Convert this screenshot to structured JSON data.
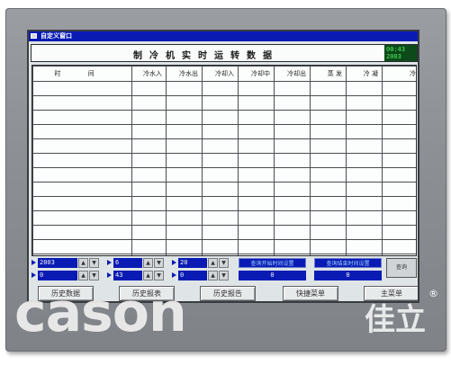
{
  "window": {
    "title": "自定义窗口"
  },
  "header": {
    "title": "制冷机实时运转数据"
  },
  "clock": {
    "time": "00:43",
    "date": "2003"
  },
  "table": {
    "columns": [
      "时 间",
      "冷水入",
      "冷水出",
      "冷却入",
      "冷却中",
      "冷却出",
      "蒸 发",
      "冷 凝",
      "冷"
    ],
    "row_count": 15
  },
  "controls": {
    "year": "2003",
    "month": "6",
    "day": "20",
    "hour": "0",
    "minute": "43",
    "second": "0",
    "query_start_label": "查询开始时间设置",
    "query_end_label": "查询结束时间设置",
    "query_start_value": "0",
    "query_end_value": "0",
    "query_button": "查询"
  },
  "bottom_buttons": [
    {
      "label": "历史数据"
    },
    {
      "label": "历史报表"
    },
    {
      "label": "历史报告"
    },
    {
      "label": "快捷菜单"
    },
    {
      "label": "主菜单"
    }
  ],
  "watermark": {
    "brand": "cason",
    "brand_cn": "佳立",
    "reg": "®"
  }
}
